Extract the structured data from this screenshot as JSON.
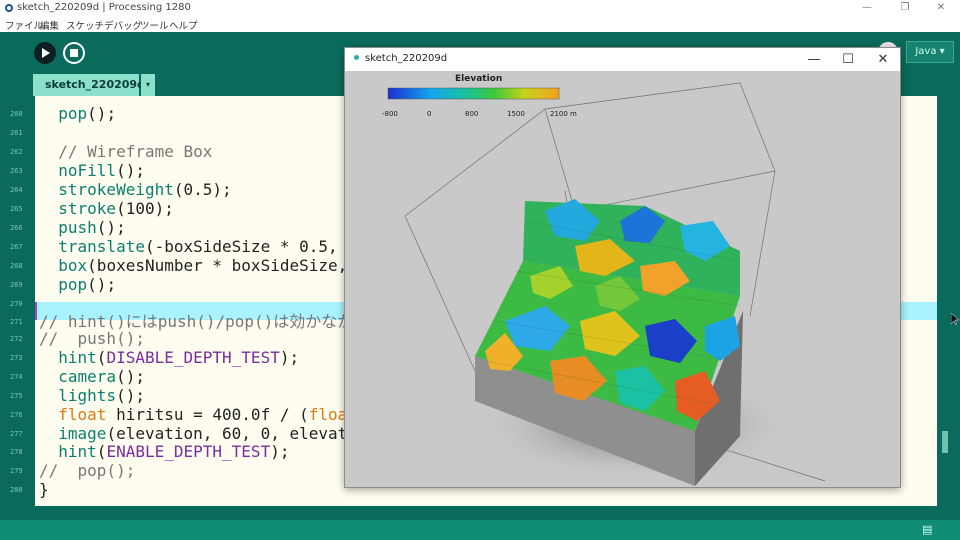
{
  "window": {
    "title": "sketch_220209d | Processing 1280",
    "controls": [
      "—",
      "❐",
      "✕"
    ]
  },
  "menu": [
    "ファイル",
    "編集",
    "スケッチ",
    "デバッグ",
    "ツール",
    "ヘルプ"
  ],
  "toolbar": {
    "run_icon": "play-icon",
    "stop_icon": "stop-icon",
    "mode_label": "Java ▾"
  },
  "tab": {
    "label": "sketch_220209d",
    "menu_arrow": "▾"
  },
  "line_numbers": [
    "260",
    "261",
    "262",
    "263",
    "264",
    "265",
    "266",
    "267",
    "268",
    "269",
    "270",
    "271",
    "272",
    "273",
    "274",
    "275",
    "276",
    "277",
    "278",
    "279",
    "280",
    "281"
  ],
  "code_lines": [
    "  pop();",
    "",
    "  // Wireframe Box",
    "  noFill();",
    "  strokeWeight(0.5);",
    "  stroke(100);",
    "  push();",
    "  translate(-boxSideSize * 0.5, -b",
    "  box(boxesNumber * boxSideSize, b",
    "  pop();",
    "",
    "// hint()にはpush()/pop()は効かなか",
    "//  push();",
    "  hint(DISABLE_DEPTH_TEST);",
    "  camera();",
    "  lights();",
    "  float hiritsu = 400.0f / (float)",
    "  image(elevation, 60, 0, elevatio",
    "  hint(ENABLE_DEPTH_TEST);",
    "//  pop();",
    "}",
    ""
  ],
  "sketch_window": {
    "title": "sketch_220209d",
    "controls": [
      "—",
      "☐",
      "✕"
    ],
    "legend": {
      "title": "Elevation",
      "ticks": [
        "-800",
        "0",
        "800",
        "1500",
        "2100 m"
      ],
      "colors": [
        "#1b2fd0",
        "#14a6ee",
        "#19c0a0",
        "#3cc83a",
        "#c9d21a",
        "#f3a020"
      ]
    }
  },
  "colors": {
    "editor_bg": "#fffdf0",
    "chrome": "#0a6b5c",
    "highlight": "#a8f3ff"
  }
}
